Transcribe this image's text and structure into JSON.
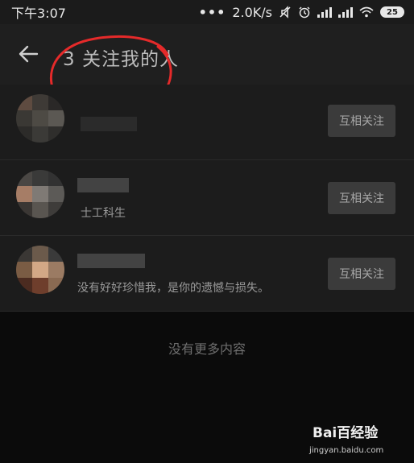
{
  "status_bar": {
    "time": "下午3:07",
    "dots": "•••",
    "speed": "2.0K/s",
    "battery": "25"
  },
  "header": {
    "title": "3 关注我的人"
  },
  "followers": [
    {
      "bio": "",
      "button": "互相关注"
    },
    {
      "bio": "士工科生",
      "button": "互相关注"
    },
    {
      "bio": "没有好好珍惜我，是你的遗憾与损失。",
      "button": "互相关注"
    }
  ],
  "footer": {
    "no_more": "没有更多内容"
  },
  "watermark": {
    "brand": "Bai百经验",
    "url": "jingyan.baidu.com"
  },
  "colors": {
    "annotation": "#e52a2a",
    "button_bg": "#3b3b3b",
    "row_bg": "#1c1c1c"
  },
  "icons": [
    "back-arrow-icon",
    "mute-icon",
    "alarm-icon",
    "signal-icon",
    "wifi-icon",
    "battery-icon"
  ]
}
